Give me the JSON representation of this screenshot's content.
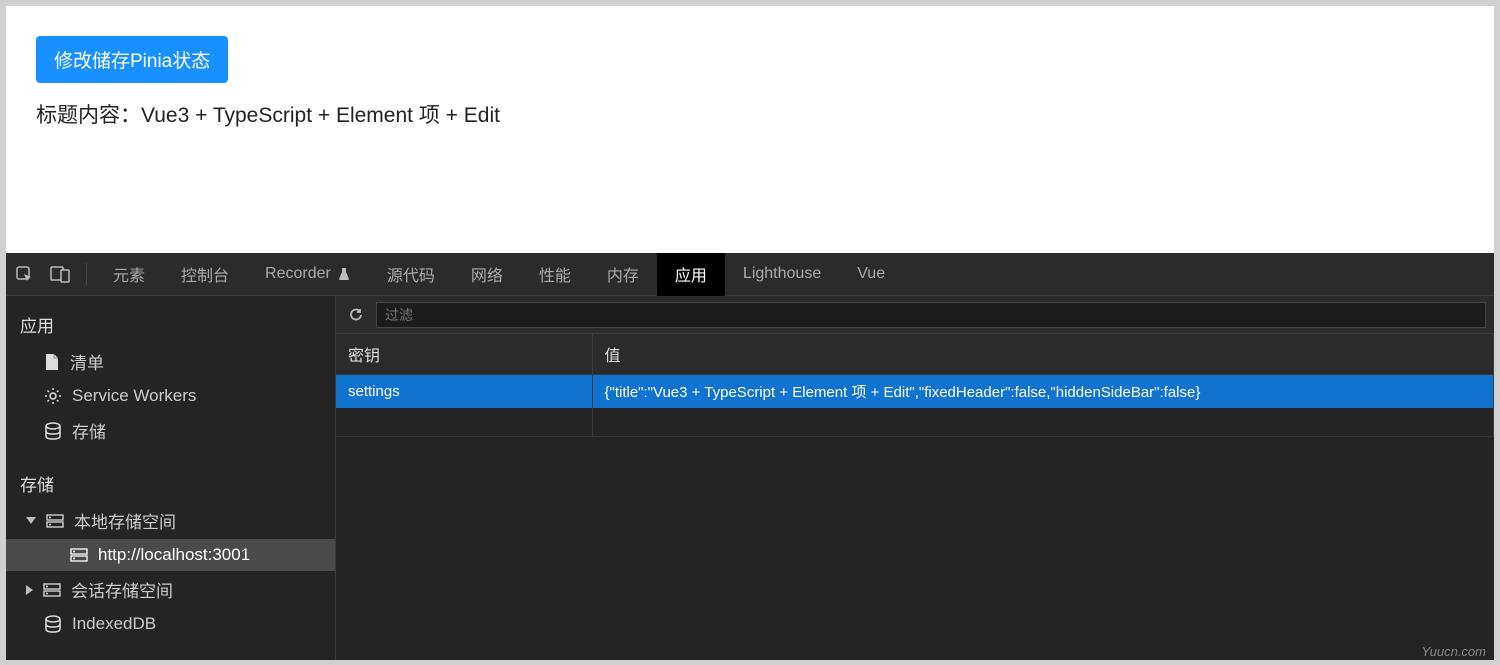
{
  "app": {
    "button_label": "修改储存Pinia状态",
    "title_text": "标题内容：Vue3 + TypeScript + Element 项 + Edit"
  },
  "devtools": {
    "tabs": {
      "elements": "元素",
      "console": "控制台",
      "recorder": "Recorder",
      "sources": "源代码",
      "network": "网络",
      "performance": "性能",
      "memory": "内存",
      "application": "应用",
      "lighthouse": "Lighthouse",
      "vue": "Vue"
    },
    "filter_placeholder": "过滤",
    "sidebar": {
      "section_app": "应用",
      "manifest": "清单",
      "service_workers": "Service Workers",
      "storage": "存储",
      "section_storage": "存储",
      "local_storage": "本地存储空间",
      "local_storage_host": "http://localhost:3001",
      "session_storage": "会话存储空间",
      "indexed_db": "IndexedDB"
    },
    "table": {
      "headers": {
        "key": "密钥",
        "value": "值"
      },
      "rows": [
        {
          "key": "settings",
          "value": "{\"title\":\"Vue3 + TypeScript + Element 项 + Edit\",\"fixedHeader\":false,\"hiddenSideBar\":false}"
        }
      ]
    }
  },
  "watermark": "Yuucn.com"
}
